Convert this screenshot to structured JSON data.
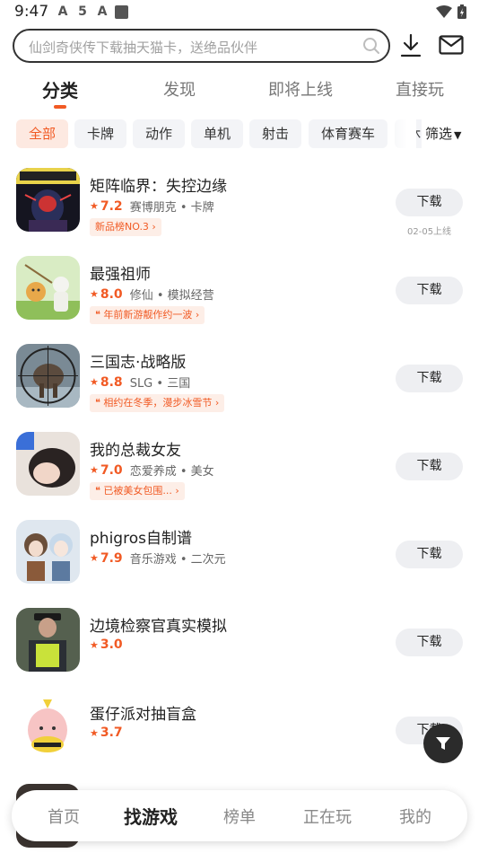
{
  "status": {
    "time": "9:47",
    "left_icons": [
      "A",
      "5",
      "A"
    ],
    "right_icons": [
      "wifi-icon",
      "battery-icon"
    ]
  },
  "search": {
    "placeholder": "仙剑奇侠传下载抽天猫卡，送绝品伙伴"
  },
  "header_icons": [
    "download-icon",
    "mail-icon"
  ],
  "tabs": [
    {
      "label": "分类",
      "active": true
    },
    {
      "label": "发现",
      "active": false
    },
    {
      "label": "即将上线",
      "active": false
    },
    {
      "label": "直接玩",
      "active": false
    }
  ],
  "chips": [
    {
      "label": "全部",
      "active": true
    },
    {
      "label": "卡牌",
      "active": false
    },
    {
      "label": "动作",
      "active": false
    },
    {
      "label": "单机",
      "active": false
    },
    {
      "label": "射击",
      "active": false
    },
    {
      "label": "体育赛车",
      "active": false
    },
    {
      "label": "休",
      "active": false
    }
  ],
  "filter": {
    "label": "筛选"
  },
  "games": [
    {
      "title": "矩阵临界：失控边缘",
      "rating": "7.2",
      "meta": "赛博朋克 • 卡牌",
      "tag": "新品榜NO.3 ›",
      "button": "下载",
      "note": "02-05上线"
    },
    {
      "title": "最强祖师",
      "rating": "8.0",
      "meta": "修仙 • 模拟经营",
      "tag": "❝ 年前新游靓作约一波 ›",
      "button": "下载",
      "note": ""
    },
    {
      "title": "三国志·战略版",
      "rating": "8.8",
      "meta": "SLG • 三国",
      "tag": "❝ 相约在冬季，漫步冰雪节 ›",
      "button": "下载",
      "note": ""
    },
    {
      "title": "我的总裁女友",
      "rating": "7.0",
      "meta": "恋爱养成 • 美女",
      "tag": "❝ 已被美女包围... ›",
      "button": "下载",
      "note": ""
    },
    {
      "title": "phigros自制谱",
      "rating": "7.9",
      "meta": "音乐游戏 • 二次元",
      "tag": "",
      "button": "下载",
      "note": ""
    },
    {
      "title": "边境检察官真实模拟",
      "rating": "3.0",
      "meta": "",
      "tag": "",
      "button": "下载",
      "note": ""
    },
    {
      "title": "蛋仔派对抽盲盒",
      "rating": "3.7",
      "meta": "",
      "tag": "",
      "button": "下载",
      "note": ""
    }
  ],
  "bottom_nav": [
    {
      "label": "首页",
      "active": false
    },
    {
      "label": "找游戏",
      "active": true
    },
    {
      "label": "榜单",
      "active": false
    },
    {
      "label": "正在玩",
      "active": false
    },
    {
      "label": "我的",
      "active": false
    }
  ],
  "colors": {
    "accent": "#f15a24",
    "chip_bg": "#f3f4f7",
    "button_bg": "#eeeff2"
  }
}
